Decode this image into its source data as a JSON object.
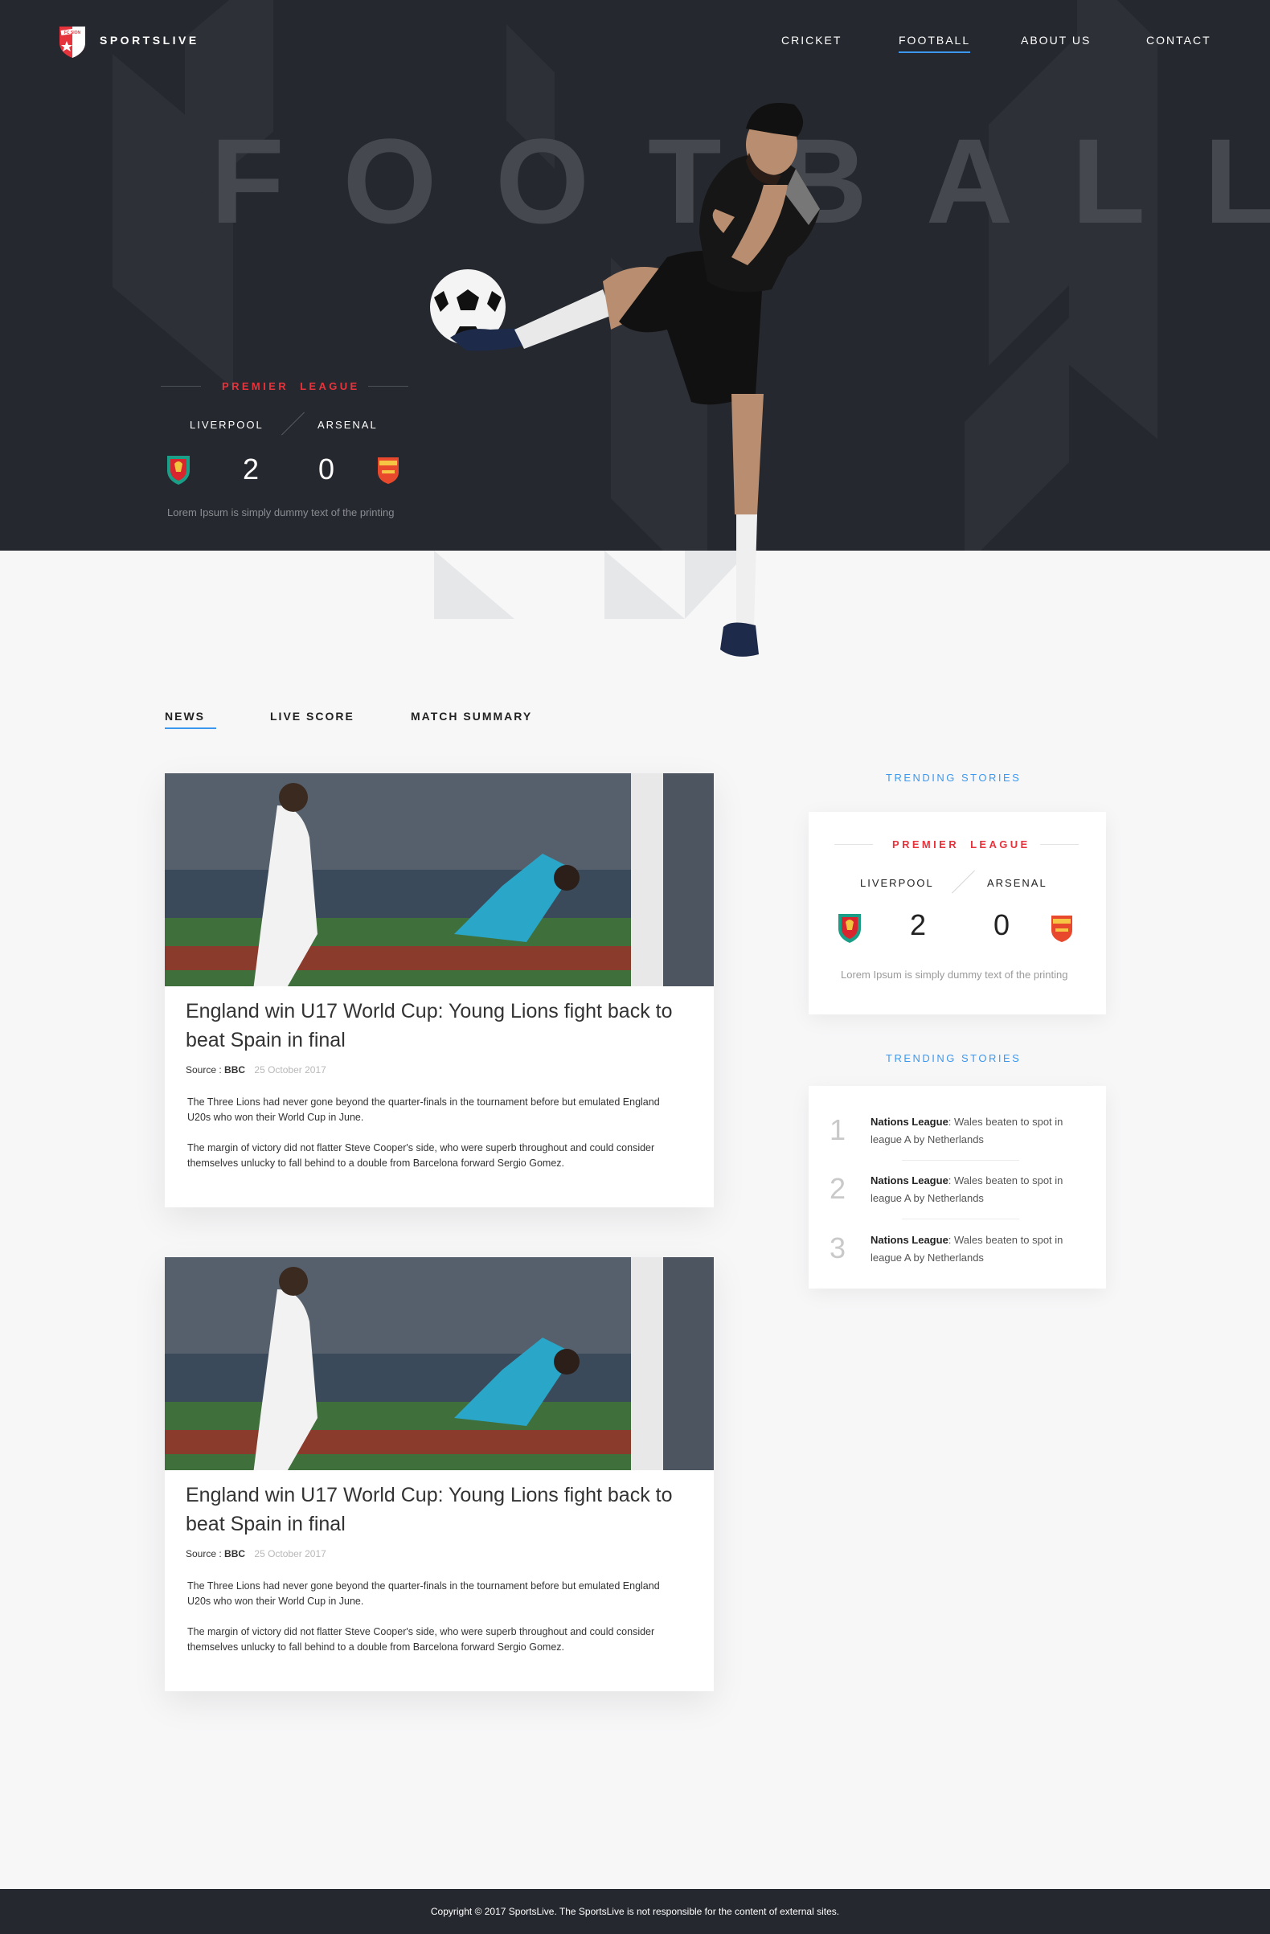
{
  "nav": {
    "brand": "SPORTSLIVE",
    "logo_text": "FC SION",
    "items": [
      {
        "label": "CRICKET"
      },
      {
        "label": "FOOTBALL"
      },
      {
        "label": "ABOUT US"
      },
      {
        "label": "CONTACT"
      }
    ],
    "active": "FOOTBALL"
  },
  "hero": {
    "title": "FOOTBALL",
    "score": {
      "league_word1": "PREMIER",
      "league_word2": "LEAGUE",
      "home": "LIVERPOOL",
      "away": "ARSENAL",
      "home_score": "2",
      "away_score": "0",
      "caption": "Lorem Ipsum is simply dummy text of the printing"
    }
  },
  "tabs": [
    {
      "label": "NEWS"
    },
    {
      "label": "LIVE SCORE"
    },
    {
      "label": "MATCH SUMMARY"
    }
  ],
  "articles": [
    {
      "headline": "England win U17 World Cup: Young Lions fight back to beat Spain in final",
      "source_label": "Source :",
      "source": "BBC",
      "date": "25 October 2017",
      "para1": "The Three Lions had never gone beyond the quarter-finals in the tournament before but emulated England U20s who won their World Cup in June.",
      "para2": "The margin of victory did not flatter Steve Cooper's side, who were superb throughout and could consider themselves unlucky to fall behind to a double from Barcelona forward Sergio Gomez."
    },
    {
      "headline": "England win U17 World Cup: Young Lions fight back to beat Spain in final",
      "source_label": "Source :",
      "source": "BBC",
      "date": "25 October 2017",
      "para1": "The Three Lions had never gone beyond the quarter-finals in the tournament before but emulated England U20s who won their World Cup in June.",
      "para2": "The margin of victory did not flatter Steve Cooper's side, who were superb throughout and could consider themselves unlucky to fall behind to a double from Barcelona forward Sergio Gomez."
    }
  ],
  "sidebar": {
    "title1": "TRENDING STORIES",
    "score": {
      "league_word1": "PREMIER",
      "league_word2": "LEAGUE",
      "home": "LIVERPOOL",
      "away": "ARSENAL",
      "home_score": "2",
      "away_score": "0",
      "caption": "Lorem Ipsum is simply dummy text of the printing"
    },
    "title2": "TRENDING STORIES",
    "stories": [
      {
        "num": "1",
        "bold": "Nations League",
        "text": ": Wales beaten to spot in league A by Netherlands"
      },
      {
        "num": "2",
        "bold": "Nations League",
        "text": ": Wales beaten to spot in league A by Netherlands"
      },
      {
        "num": "3",
        "bold": "Nations League",
        "text": ": Wales beaten to spot in league A by Netherlands"
      }
    ]
  },
  "footer": {
    "text": "Copyright © 2017 SportsLive. The SportsLive is not responsible for the content of external sites."
  },
  "colors": {
    "hero_bg": "#25282e",
    "accent_blue": "#3c98ef",
    "accent_red": "#e6343d",
    "page_bg": "#f7f7f8"
  }
}
